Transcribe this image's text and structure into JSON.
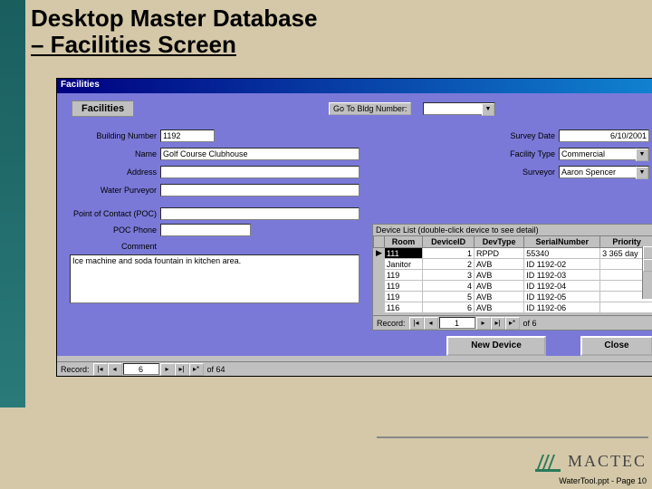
{
  "slide": {
    "title_line1": "Desktop Master  Database",
    "title_line2": "– Facilities Screen"
  },
  "window": {
    "title": "Facilities",
    "tab": "Facilities",
    "goto_label": "Go To Bldg Number:"
  },
  "fields": {
    "building_number": {
      "label": "Building Number",
      "value": "1192"
    },
    "name": {
      "label": "Name",
      "value": "Golf Course Clubhouse"
    },
    "address": {
      "label": "Address",
      "value": ""
    },
    "water_purveyor": {
      "label": "Water Purveyor",
      "value": ""
    },
    "poc": {
      "label": "Point of Contact (POC)",
      "value": ""
    },
    "poc_phone": {
      "label": "POC Phone",
      "value": ""
    },
    "comment": {
      "label": "Comment",
      "value": "Ice machine and soda fountain in kitchen area."
    },
    "survey_date": {
      "label": "Survey Date",
      "value": "6/10/2001"
    },
    "facility_type": {
      "label": "Facility Type",
      "value": "Commercial"
    },
    "surveyor": {
      "label": "Surveyor",
      "value": "Aaron Spencer"
    }
  },
  "device_list": {
    "caption": "Device List (double-click device to see detail)",
    "headers": [
      "Room",
      "DeviceID",
      "DevType",
      "SerialNumber",
      "Priority"
    ],
    "rows": [
      {
        "room": "111",
        "device_id": "1",
        "dev_type": "RPPD",
        "serial": "55340",
        "priority": "3 365 day",
        "selected": true
      },
      {
        "room": "Janitor",
        "device_id": "2",
        "dev_type": "AVB",
        "serial": "ID 1192-02",
        "priority": ""
      },
      {
        "room": "119",
        "device_id": "3",
        "dev_type": "AVB",
        "serial": "ID 1192-03",
        "priority": ""
      },
      {
        "room": "119",
        "device_id": "4",
        "dev_type": "AVB",
        "serial": "ID 1192-04",
        "priority": ""
      },
      {
        "room": "119",
        "device_id": "5",
        "dev_type": "AVB",
        "serial": "ID 1192-05",
        "priority": ""
      },
      {
        "room": "116",
        "device_id": "6",
        "dev_type": "AVB",
        "serial": "ID 1192-06",
        "priority": ""
      }
    ],
    "nav": {
      "label": "Record:",
      "current": "1",
      "of": "of 6"
    }
  },
  "buttons": {
    "new_device": "New Device",
    "close": "Close"
  },
  "outer_nav": {
    "label": "Record:",
    "current": "6",
    "of": "of 64"
  },
  "logo": {
    "text": "MACTEC"
  },
  "footer": "WaterTool.ppt - Page 10"
}
